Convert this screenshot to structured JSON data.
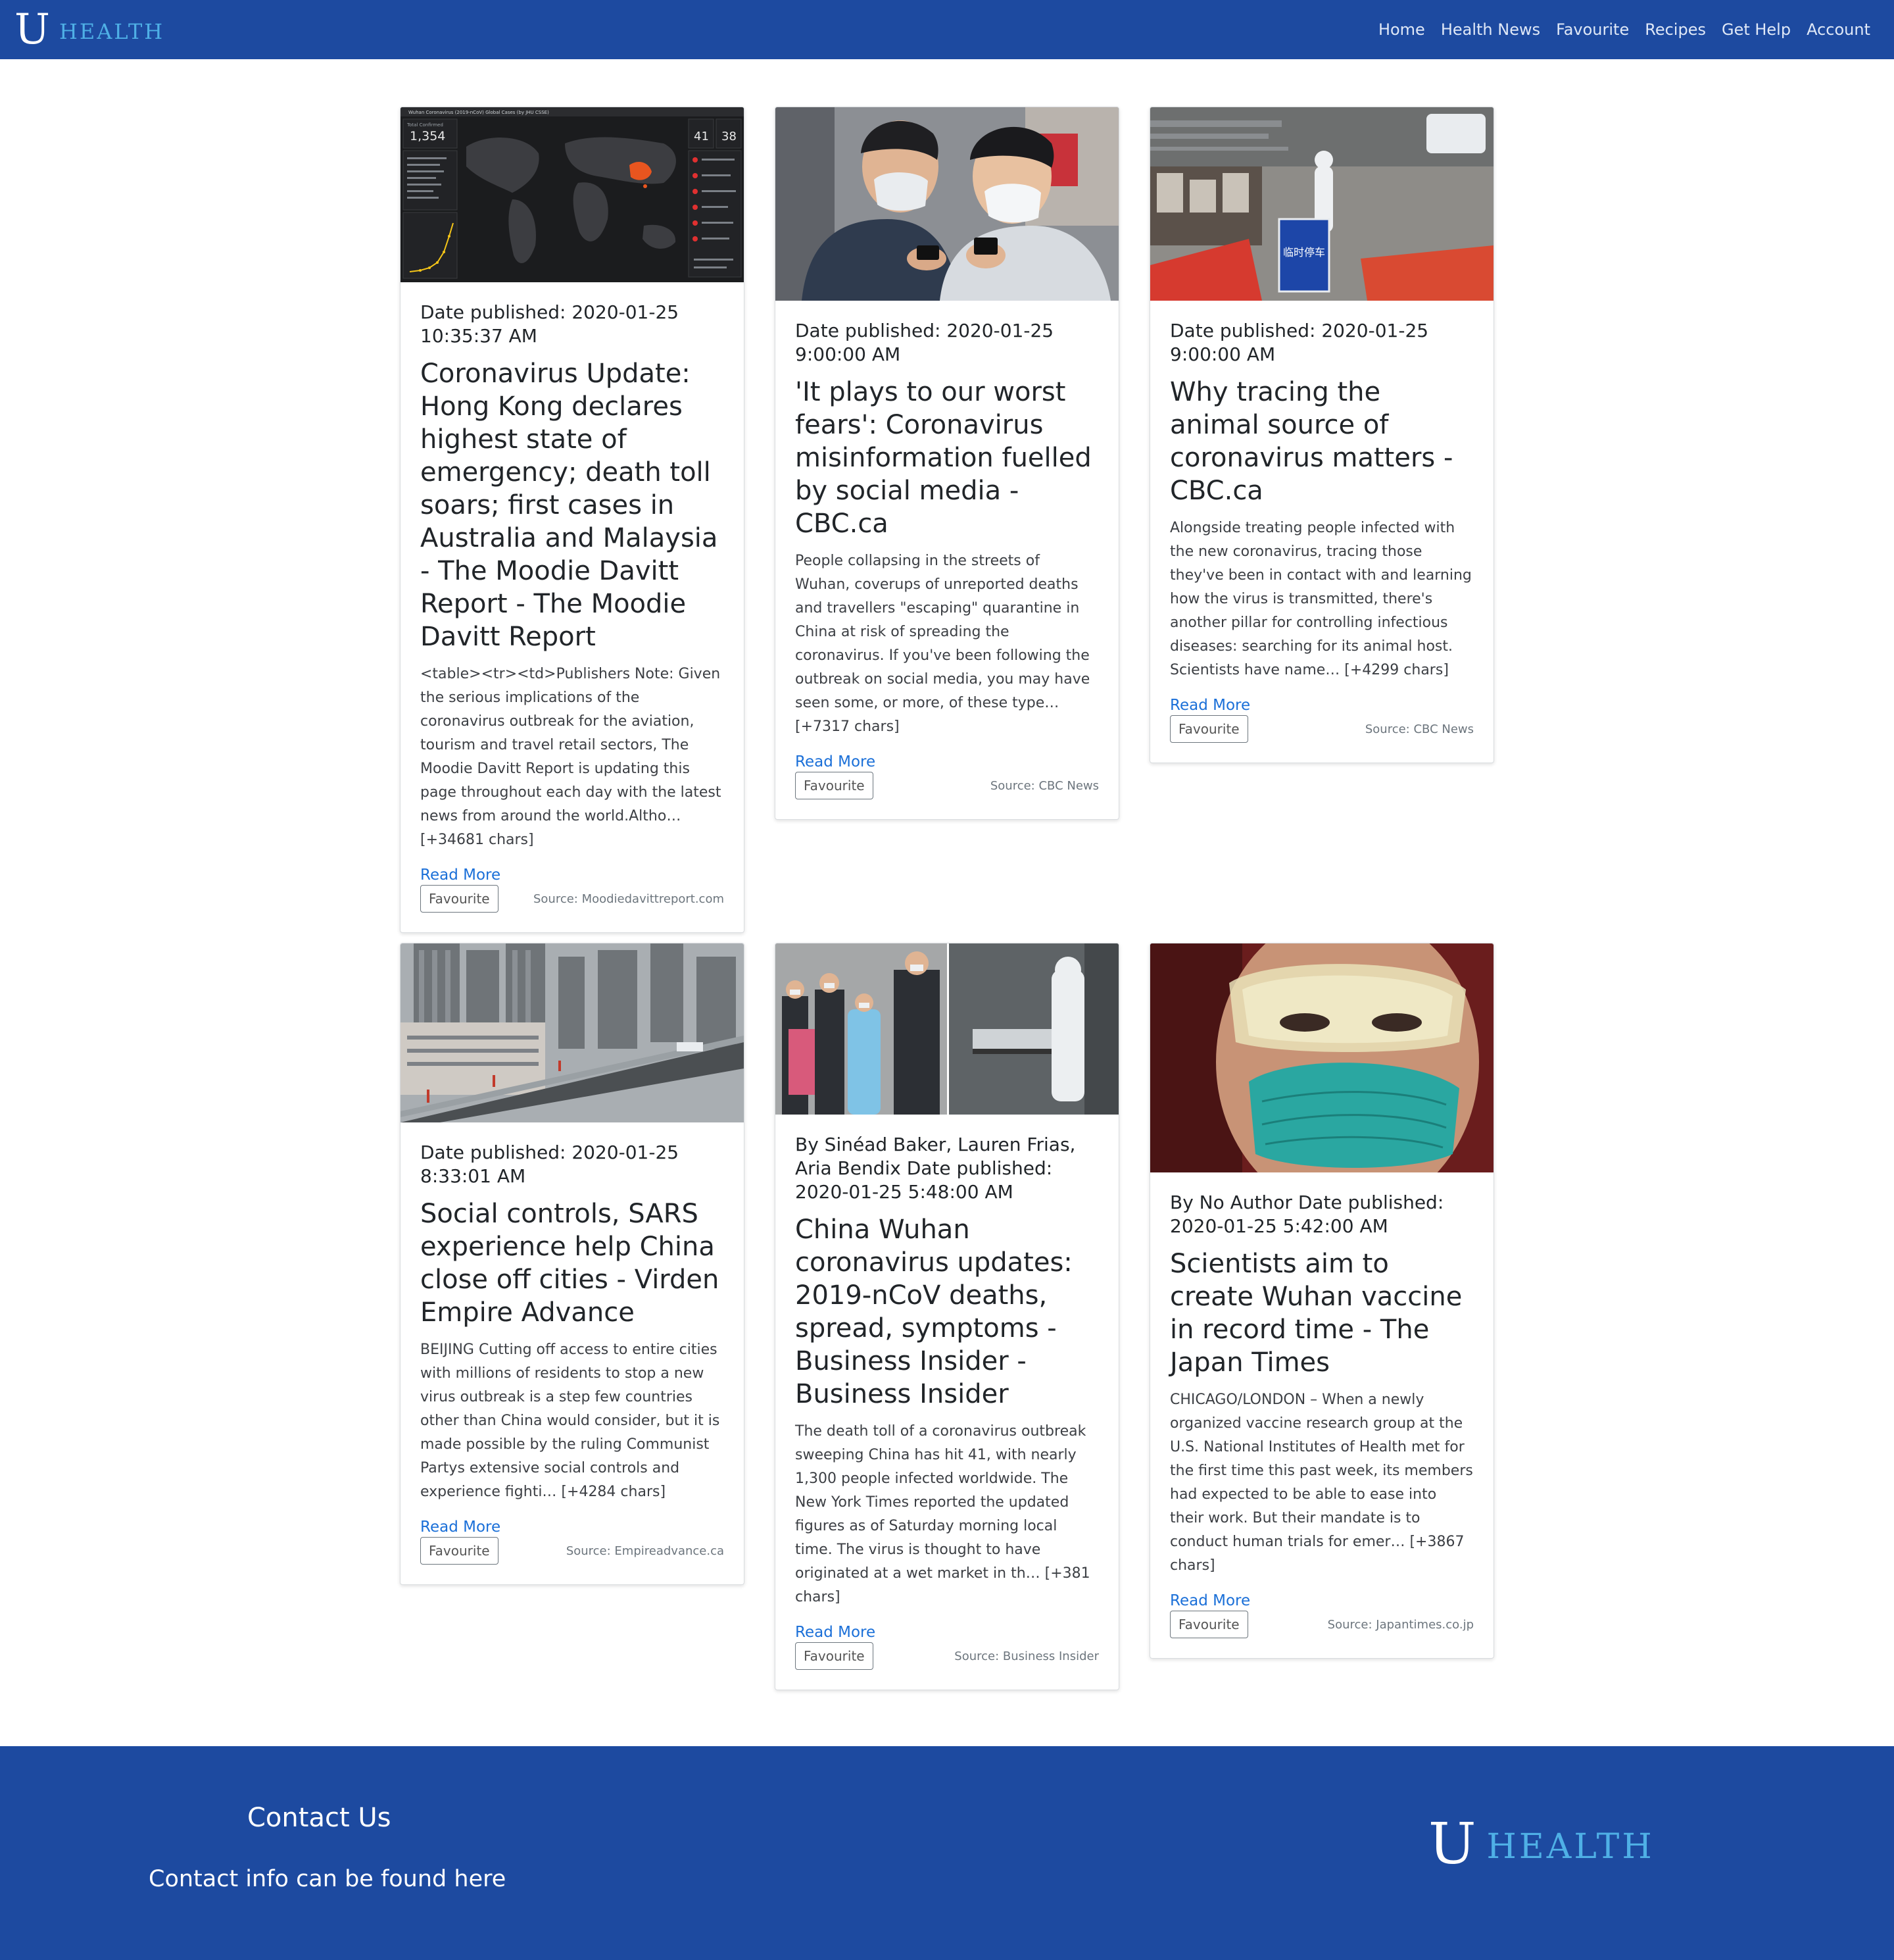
{
  "brand": {
    "letter": "U",
    "name": "HEALTH"
  },
  "nav": {
    "links": [
      "Home",
      "Health News",
      "Favourite",
      "Recipes",
      "Get Help",
      "Account"
    ]
  },
  "colors": {
    "navbar": "#1d4aa0",
    "link": "#1a6fd8",
    "brand_accent": "#4fb0e6"
  },
  "articles": [
    {
      "meta": "Date published: 2020-01-25 10:35:37 AM",
      "title": "Coronavirus Update: Hong Kong declares highest state of emergency; death toll soars; first cases in Australia and Malaysia - The Moodie Davitt Report - The Moodie Davitt Report",
      "description": "<table><tr><td>Publishers Note: Given the serious implications of the coronavirus outbreak for the aviation, tourism and travel retail sectors, The Moodie Davitt Report is updating this page throughout each day with the latest news from around the world.Altho… [+34681 chars]",
      "read_more": "Read More",
      "favourite": "Favourite",
      "source": "Source: Moodiedavittreport.com",
      "image": {
        "map_header": "Wuhan Coronavirus (2019-nCoV) Global Cases (by JHU CSSE)",
        "total_label": "Total Confirmed",
        "confirmed": "1,354",
        "box_a": "41",
        "box_b": "38"
      }
    },
    {
      "meta": "Date published: 2020-01-25 9:00:00 AM",
      "title": "'It plays to our worst fears': Coronavirus misinformation fuelled by social media - CBC.ca",
      "description": "People collapsing in the streets of Wuhan, coverups of unreported deaths and travellers \"escaping\" quarantine in China at risk of spreading the coronavirus. If you've been following the outbreak on social media, you may have seen some, or more, of these type… [+7317 chars]",
      "read_more": "Read More",
      "favourite": "Favourite",
      "source": "Source: CBC News"
    },
    {
      "meta": "Date published: 2020-01-25 9:00:00 AM",
      "title": "Why tracing the animal source of coronavirus matters - CBC.ca",
      "description": "Alongside treating people infected with the new coronavirus, tracing those they've been in contact with and learning how the virus is transmitted, there's another pillar for controlling infectious diseases: searching for its animal host. Scientists have name… [+4299 chars]",
      "read_more": "Read More",
      "favourite": "Favourite",
      "source": "Source: CBC News",
      "image": {
        "sign_text": "临时停车"
      }
    },
    {
      "meta": "Date published: 2020-01-25 8:33:01 AM",
      "title": "Social controls, SARS experience help China close off cities - Virden Empire Advance",
      "description": "BEIJING Cutting off access to entire cities with millions of residents to stop a new virus outbreak is a step few countries other than China would consider, but it is made possible by the ruling Communist Partys extensive social controls and experience fighti… [+4284 chars]",
      "read_more": "Read More",
      "favourite": "Favourite",
      "source": "Source: Empireadvance.ca"
    },
    {
      "meta": "By Sinéad Baker, Lauren Frias, Aria Bendix Date published: 2020-01-25 5:48:00 AM",
      "title": "China Wuhan coronavirus updates: 2019-nCoV deaths, spread, symptoms - Business Insider - Business Insider",
      "description": "The death toll of a coronavirus outbreak sweeping China has hit 41, with nearly 1,300 people infected worldwide. The New York Times reported the updated figures as of Saturday morning local time. The virus is thought to have originated at a wet market in th… [+381 chars]",
      "read_more": "Read More",
      "favourite": "Favourite",
      "source": "Source: Business Insider"
    },
    {
      "meta": "By No Author Date published: 2020-01-25 5:42:00 AM",
      "title": "Scientists aim to create Wuhan vaccine in record time - The Japan Times",
      "description": "CHICAGO/LONDON – When a newly organized vaccine research group at the U.S. National Institutes of Health met for the first time this past week, its members had expected to be able to ease into their work. But their mandate is to conduct human trials for emer… [+3867 chars]",
      "read_more": "Read More",
      "favourite": "Favourite",
      "source": "Source: Japantimes.co.jp"
    }
  ],
  "footer": {
    "contact_title": "Contact Us",
    "contact_info": "Contact info can be found here"
  }
}
